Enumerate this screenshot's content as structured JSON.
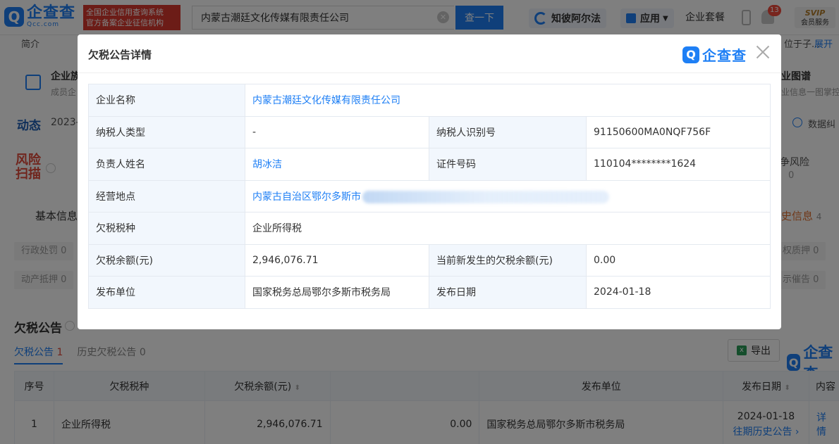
{
  "topbar": {
    "logo_cn": "企查查",
    "logo_en": "Qcc.com",
    "cert_line1": "全国企业信用查询系统",
    "cert_line2": "官方备案企业征信机构",
    "search_value": "内蒙古潮廷文化传媒有限责任公司",
    "search_button": "查一下",
    "nav_zhibi": "知彼阿尔法",
    "nav_apps": "应用",
    "nav_package": "企业套餐",
    "notification_count": "13",
    "svip_label": "SVIP",
    "svip_sub": "会员服务"
  },
  "background": {
    "intro": "简介",
    "expand": "展开",
    "position_hint": "位于子...",
    "graph_left": "企业族",
    "graph_left_sub": "成员企",
    "graph_right": "业图谱",
    "graph_right_sub": "业信息一图掌控",
    "dynamic_title": "动态",
    "dynamic_date": "2023-",
    "data_error": "数据纠",
    "risk_line1": "风险",
    "risk_line2": "扫描",
    "risk_right": "争风险",
    "risk_right_count": "0",
    "basic_info": "基本信息",
    "history_info": "史信息",
    "history_info_count": "4",
    "chips": [
      "行政处罚 0",
      "动产抵押 0",
      "权质押 0",
      "示催告 0"
    ],
    "section_title": "欠税公告",
    "tab_active": "欠税公告",
    "tab_active_count": "1",
    "tab_history": "历史欠税公告",
    "tab_history_count": "0",
    "export_label": "导出",
    "bg_logo": "企查查",
    "table_headers": [
      "序号",
      "欠税税种",
      "欠税余额(元)",
      "",
      "发布单位",
      "发布日期",
      "内容"
    ],
    "table_row": {
      "index": "1",
      "tax_type": "企业所得税",
      "balance": "2,946,076.71",
      "current": "0.00",
      "publisher": "国家税务总局鄂尔多斯市税务局",
      "date": "2024-01-18",
      "history_link": "往期历史公告",
      "detail_link": "详情"
    }
  },
  "modal": {
    "title": "欠税公告详情",
    "logo": "企查查",
    "rows": {
      "company_label": "企业名称",
      "company_value": "内蒙古潮廷文化传媒有限责任公司",
      "taxpayer_type_label": "纳税人类型",
      "taxpayer_type_value": "-",
      "taxpayer_id_label": "纳税人识别号",
      "taxpayer_id_value": "91150600MA0NQF756F",
      "person_label": "负责人姓名",
      "person_value": "胡冰洁",
      "cert_label": "证件号码",
      "cert_value": "110104********1624",
      "address_label": "经营地点",
      "address_value": "内蒙古自治区鄂尔多斯市",
      "tax_type_label": "欠税税种",
      "tax_type_value": "企业所得税",
      "balance_label": "欠税余额(元)",
      "balance_value": "2,946,076.71",
      "new_balance_label": "当前新发生的欠税余额(元)",
      "new_balance_value": "0.00",
      "publisher_label": "发布单位",
      "publisher_value": "国家税务总局鄂尔多斯市税务局",
      "date_label": "发布日期",
      "date_value": "2024-01-18"
    }
  },
  "colors": {
    "accent": "#1e7ff5",
    "cert_red": "#d8392f",
    "label_bg": "#f2f7fd"
  }
}
